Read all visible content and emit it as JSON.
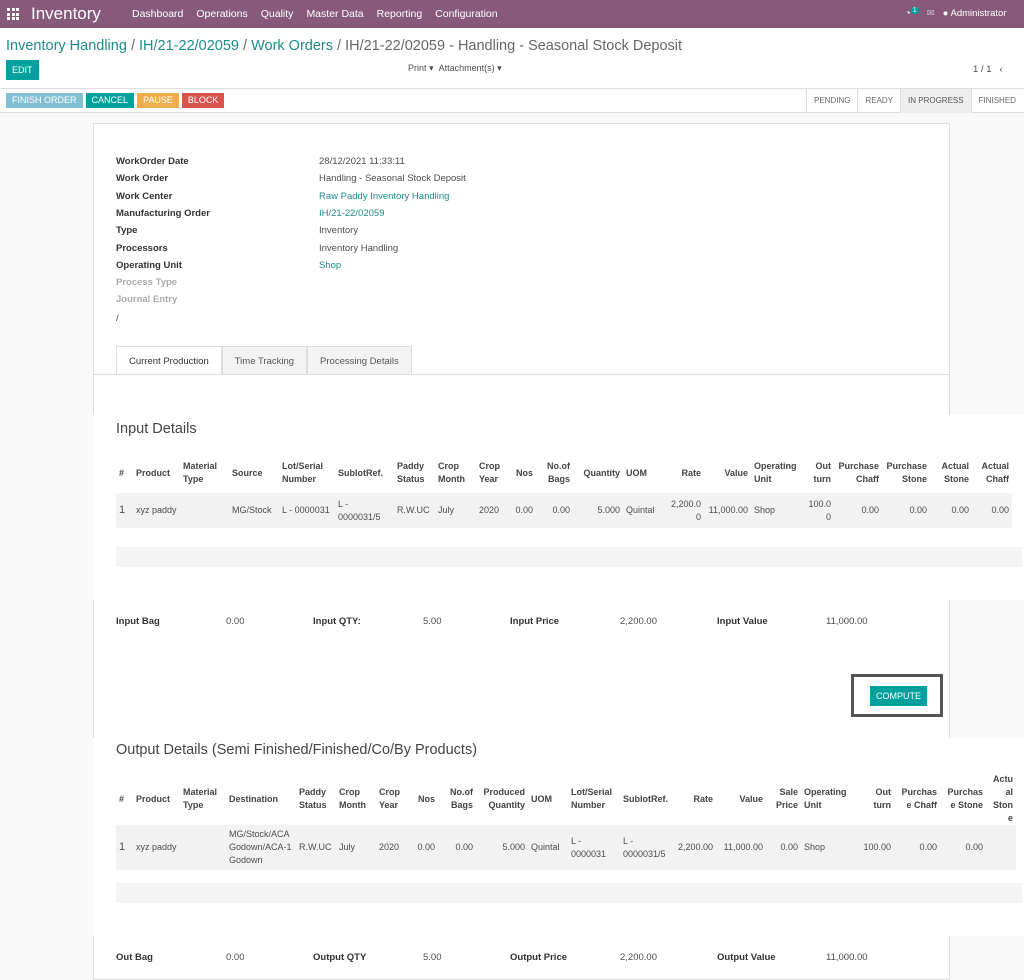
{
  "nav": {
    "app": "Inventory",
    "menu": [
      "Dashboard",
      "Operations",
      "Quality",
      "Master Data",
      "Reporting",
      "Configuration"
    ],
    "notif_count": "1",
    "user": "Administrator"
  },
  "breadcrumb": [
    "Inventory Handling",
    "IH/21-22/02059",
    "Work Orders",
    "IH/21-22/02059 - Handling - Seasonal Stock Deposit"
  ],
  "toolbar": {
    "edit": "EDIT",
    "print": "Print",
    "attachments": "Attachment(s)",
    "pager": "1 / 1"
  },
  "actions": [
    {
      "label": "FINISH ORDER",
      "color": "#82bfd2"
    },
    {
      "label": "CANCEL",
      "color": "#00A09D"
    },
    {
      "label": "PAUSE",
      "color": "#f0ad4e"
    },
    {
      "label": "BLOCK",
      "color": "#d9534f"
    }
  ],
  "stages": [
    "PENDING",
    "READY",
    "IN PROGRESS",
    "FINISHED"
  ],
  "active_stage": "IN PROGRESS",
  "fields": [
    {
      "label": "WorkOrder Date",
      "value": "28/12/2021 11:33:11",
      "link": false
    },
    {
      "label": "Work Order",
      "value": "Handling - Seasonal Stock Deposit",
      "link": false
    },
    {
      "label": "Work Center",
      "value": "Raw Paddy Inventory Handling",
      "link": true
    },
    {
      "label": "Manufacturing Order",
      "value": "IH/21-22/02059",
      "link": true
    },
    {
      "label": "Type",
      "value": "Inventory",
      "link": false
    },
    {
      "label": "Processors",
      "value": "Inventory Handling",
      "link": false
    },
    {
      "label": "Operating Unit",
      "value": "Shop",
      "link": true
    },
    {
      "label": "Process Type",
      "value": "",
      "link": false
    },
    {
      "label": "Journal Entry",
      "value": "",
      "link": false
    }
  ],
  "slash": "/",
  "tabs": [
    "Current Production",
    "Time Tracking",
    "Processing Details"
  ],
  "input": {
    "title": "Input Details",
    "headers": [
      "#",
      "Product",
      "Material Type",
      "Source",
      "Lot/Serial Number",
      "SublotRef.",
      "Paddy Status",
      "Crop Month",
      "Crop Year",
      "Nos",
      "No.of Bags",
      "Quantity",
      "UOM",
      "Rate",
      "Value",
      "Operating Unit",
      "Out turn",
      "Purchase Chaff",
      "Purchase Stone",
      "Actual Stone",
      "Actual Chaff"
    ],
    "rows": [
      [
        "1",
        "xyz paddy",
        "",
        "MG/Stock",
        "L - 0000031",
        "L - 0000031/5",
        "R.W.UC",
        "July",
        "2020",
        "0.00",
        "0.00",
        "5.000",
        "Quintal",
        "2,200.00",
        "11,000.00",
        "Shop",
        "100.00",
        "0.00",
        "0.00",
        "0.00",
        "0.00"
      ]
    ],
    "summary": [
      [
        "Input Bag",
        "0.00"
      ],
      [
        "Input QTY:",
        "5.00"
      ],
      [
        "Input Price",
        "2,200.00"
      ],
      [
        "Input Value",
        "11,000.00"
      ]
    ]
  },
  "compute": "COMPUTE",
  "output": {
    "title": "Output Details (Semi Finished/Finished/Co/By Products)",
    "headers": [
      "#",
      "Product",
      "Material Type",
      "Destination",
      "Paddy Status",
      "Crop Month",
      "Crop Year",
      "Nos",
      "No.of Bags",
      "Produced Quantity",
      "UOM",
      "Lot/Serial Number",
      "SublotRef.",
      "Rate",
      "Value",
      "Sale Price",
      "Operating Unit",
      "Out turn",
      "Purchase Chaff",
      "Purchase Stone",
      "Actual Stone"
    ],
    "rows": [
      [
        "1",
        "xyz paddy",
        "",
        "MG/Stock/ACA Godown/ACA-1 Godown",
        "R.W.UC",
        "July",
        "2020",
        "0.00",
        "0.00",
        "5.000",
        "Quintal",
        "L - 0000031",
        "L - 0000031/5",
        "2,200.00",
        "11,000.00",
        "0.00",
        "Shop",
        "100.00",
        "0.00",
        "0.00",
        ""
      ]
    ],
    "summary": [
      [
        "Out Bag",
        "0.00"
      ],
      [
        "Output QTY",
        "5.00"
      ],
      [
        "Output Price",
        "2,200.00"
      ],
      [
        "Output Value",
        "11,000.00"
      ]
    ]
  }
}
